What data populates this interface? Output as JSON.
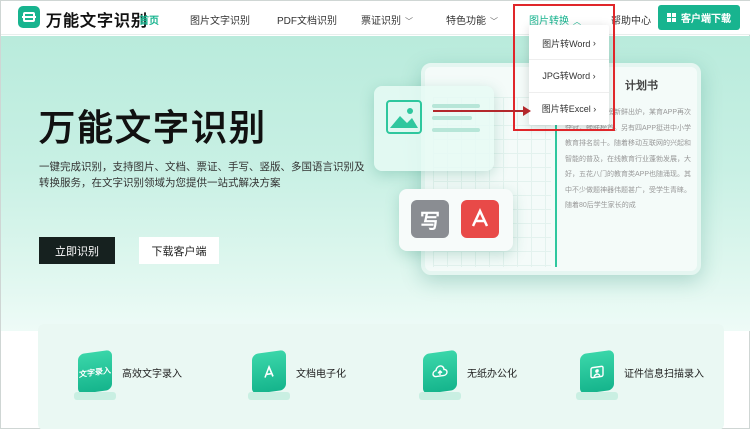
{
  "header": {
    "brand": "万能文字识别",
    "nav": [
      {
        "label": "首页",
        "active": true
      },
      {
        "label": "图片文字识别"
      },
      {
        "label": "PDF文档识别"
      },
      {
        "label": "票证识别"
      },
      {
        "label": "特色功能"
      },
      {
        "label": "图片转换"
      },
      {
        "label": "帮助中心"
      }
    ],
    "download_button": "客户端下载"
  },
  "dropdown": {
    "items": [
      {
        "label": "图片转Word",
        "chevron": "›"
      },
      {
        "label": "JPG转Word",
        "chevron": "›"
      },
      {
        "label": "图片转Excel",
        "chevron": "›"
      }
    ]
  },
  "hero": {
    "title": "万能文字识别",
    "subtitle": "一键完成识别，支持图片、文档、票证、手写、竖版、多国语言识别及转换服务，在文字识别领域为您提供一站式解决方案",
    "primary_button": "立即识别",
    "secondary_button": "下载客户端"
  },
  "illustration": {
    "doc_heading": "计划书",
    "doc_text": "教育APP风云榜新鲜出炉，某育APP再次夺冠，蝉联榜首。另有四APP挺进中小学教育排名前十。随着移动互联网的兴起和智能的普及，在线教育行业蓬勃发展，大好，五花八门的教育类APP也随涌现。其中不少做题神器伟题甚广，受学生青睐。随着80后学生家长的成"
  },
  "features": [
    {
      "label": "高效文字录入",
      "icon": "text-input-icon",
      "icon_text": "文字录入"
    },
    {
      "label": "文档电子化",
      "icon": "pdf-document-icon",
      "icon_text": ""
    },
    {
      "label": "无纸办公化",
      "icon": "cloud-upload-icon",
      "icon_text": ""
    },
    {
      "label": "证件信息扫描录入",
      "icon": "id-card-icon",
      "icon_text": ""
    }
  ],
  "colors": {
    "accent": "#18b48f",
    "highlight": "#e0262a",
    "dark_button": "#16211f"
  }
}
